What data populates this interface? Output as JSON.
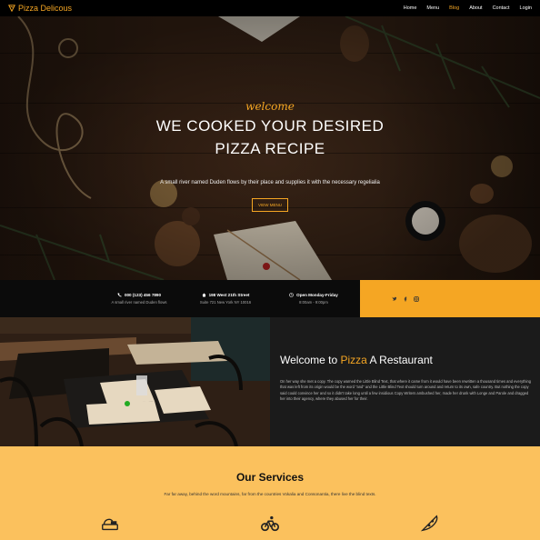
{
  "nav": {
    "brand": "Pizza Delicous",
    "links": [
      "Home",
      "Menu",
      "Blog",
      "About",
      "Contact",
      "Login"
    ]
  },
  "hero": {
    "welcome": "welcome",
    "title_line1": "WE COOKED YOUR DESIRED",
    "title_line2": "PIZZA RECIPE",
    "subtitle": "A small river named Duden flows by their place and supplies it with the necessary regelialia",
    "button": "VIEW MENU"
  },
  "info": [
    {
      "title": "000 (123) 456 7890",
      "sub": "A small river named Duden flows",
      "icon": "phone-icon"
    },
    {
      "title": "198 West 21th Street",
      "sub": "Suite 721 New York NY 10016",
      "icon": "location-icon"
    },
    {
      "title": "Open Monday-Friday",
      "sub": "8:00am - 9:00pm",
      "icon": "clock-icon"
    }
  ],
  "social": [
    "twitter-icon",
    "facebook-icon",
    "instagram-icon"
  ],
  "about": {
    "title_pre": "Welcome to ",
    "title_highlight": "Pizza",
    "title_post": " A Restaurant",
    "body": "On her way she met a copy. The copy warned the Little Blind Text, that where it came from it would have been rewritten a thousand times and everything that was left from its origin would be the word \"and\" and the Little Blind Text should turn around and return to its own, safe country. But nothing the copy said could convince her and so it didn't take long until a few insidious Copy Writers ambushed her, made her drunk with Longe and Parole and dragged her into their agency, where they abused her for their."
  },
  "services": {
    "title": "Our Services",
    "subtitle": "Far far away, behind the word mountains, far from the countries Vokalia and Consonantia, there live the blind texts.",
    "icons": [
      "food-icon",
      "bicycle-icon",
      "pizza-icon"
    ]
  },
  "colors": {
    "accent": "#f5a623",
    "services_bg": "#fbc15d"
  }
}
